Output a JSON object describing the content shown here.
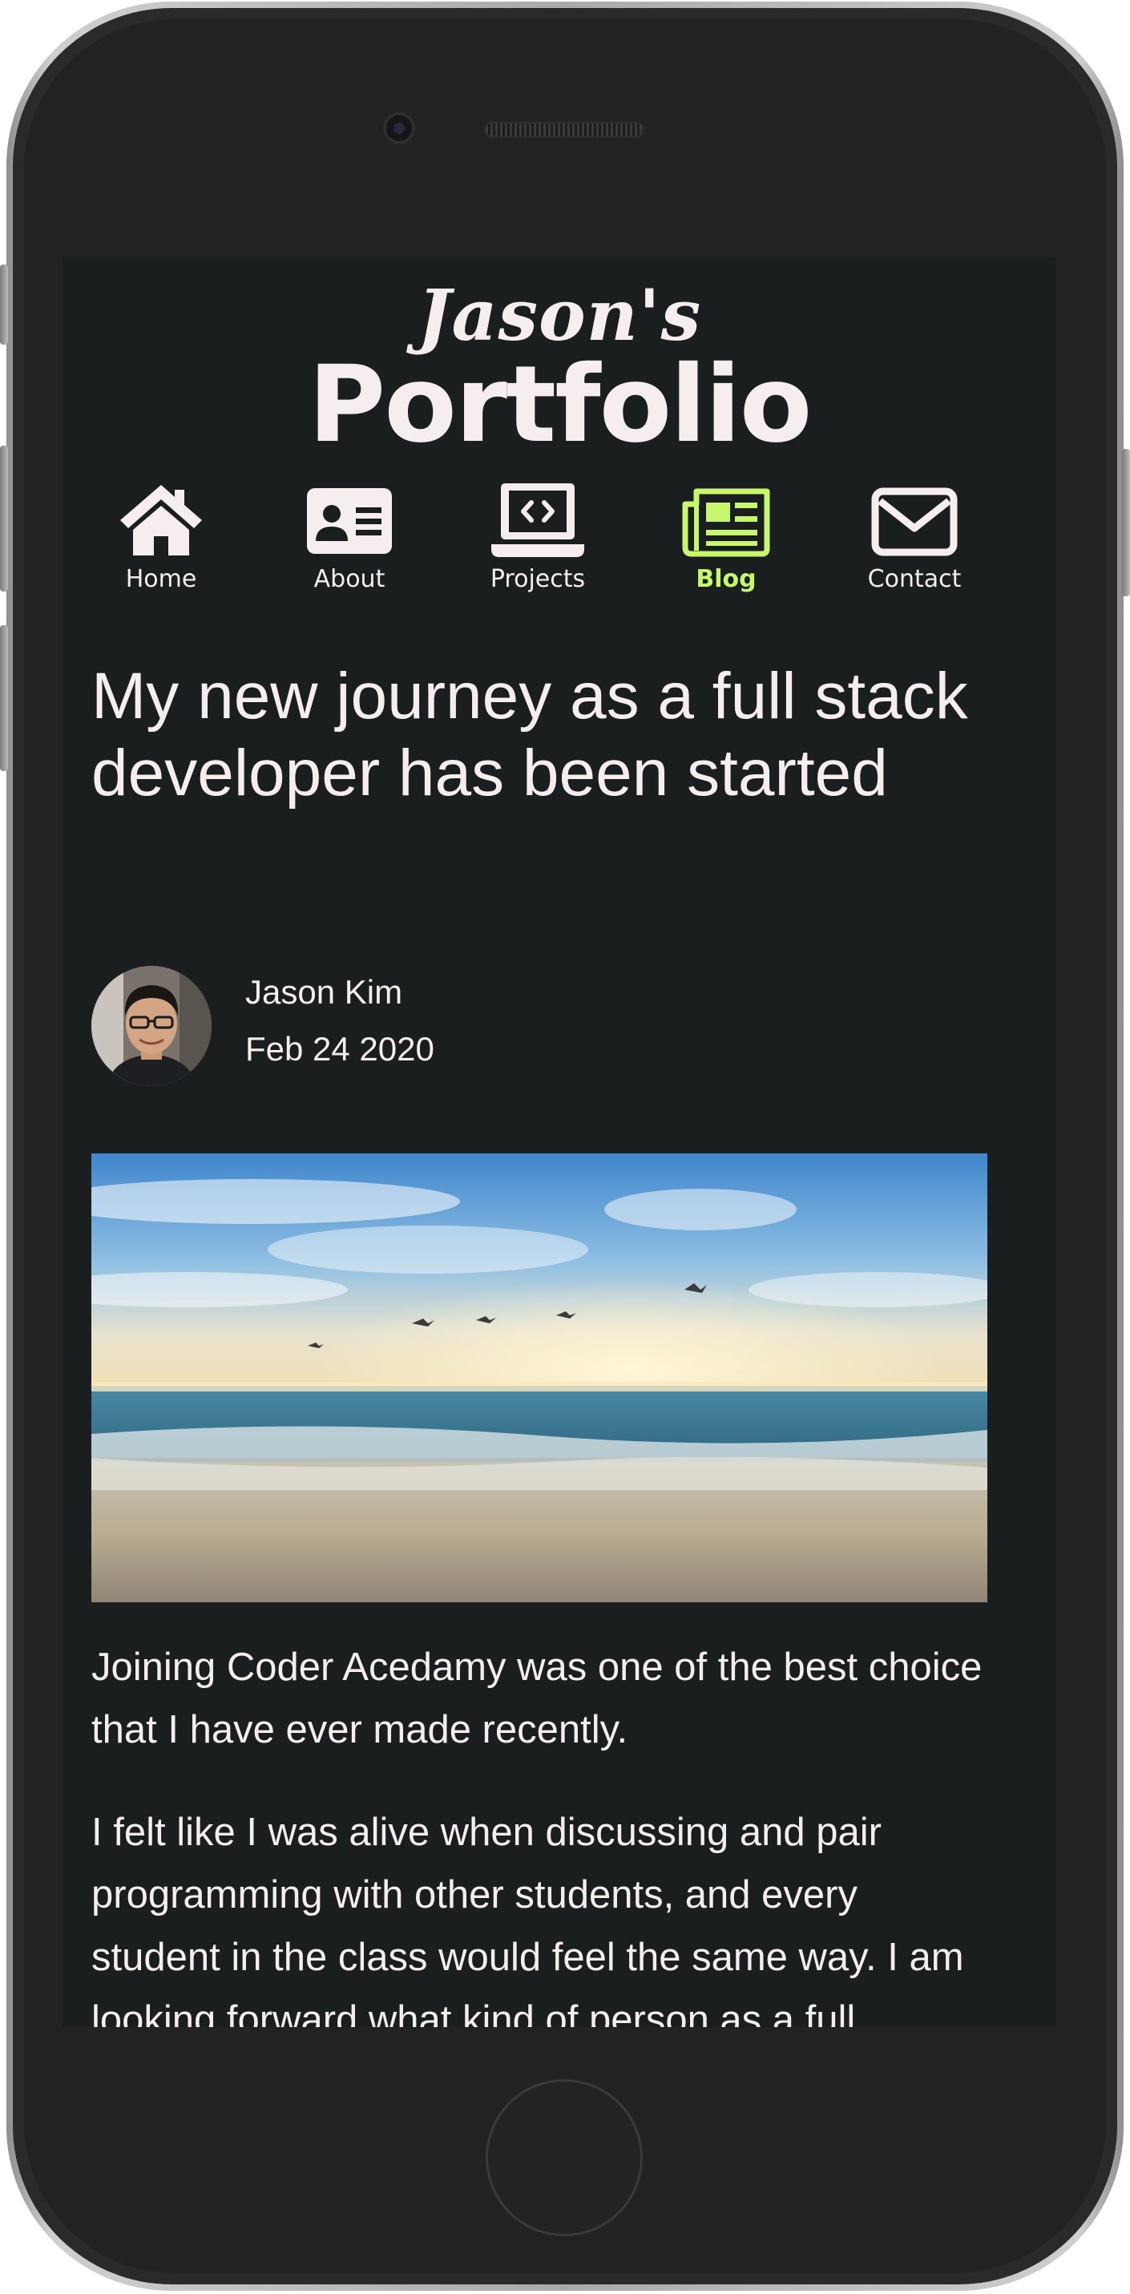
{
  "site": {
    "logo_script": "Jason's",
    "logo_main": "Portfolio"
  },
  "nav": {
    "items": [
      {
        "label": "Home",
        "icon": "home-icon"
      },
      {
        "label": "About",
        "icon": "id-card-icon"
      },
      {
        "label": "Projects",
        "icon": "laptop-code-icon"
      },
      {
        "label": "Blog",
        "icon": "newspaper-icon",
        "active": true
      },
      {
        "label": "Contact",
        "icon": "envelope-icon"
      }
    ]
  },
  "post": {
    "title": "My new journey as a full stack developer has been started",
    "author": "Jason Kim",
    "date": "Feb 24 2020",
    "paragraphs": [
      "Joining Coder Acedamy was one of the best choice that I have ever made recently.",
      "I felt like I was alive when discussing and pair programming with other students, and every student in the class would feel the same way. I am looking forward what kind of person as a full"
    ]
  },
  "colors": {
    "background": "#1b1e1e",
    "text": "#f6eeee",
    "accent": "#c8f76e"
  }
}
